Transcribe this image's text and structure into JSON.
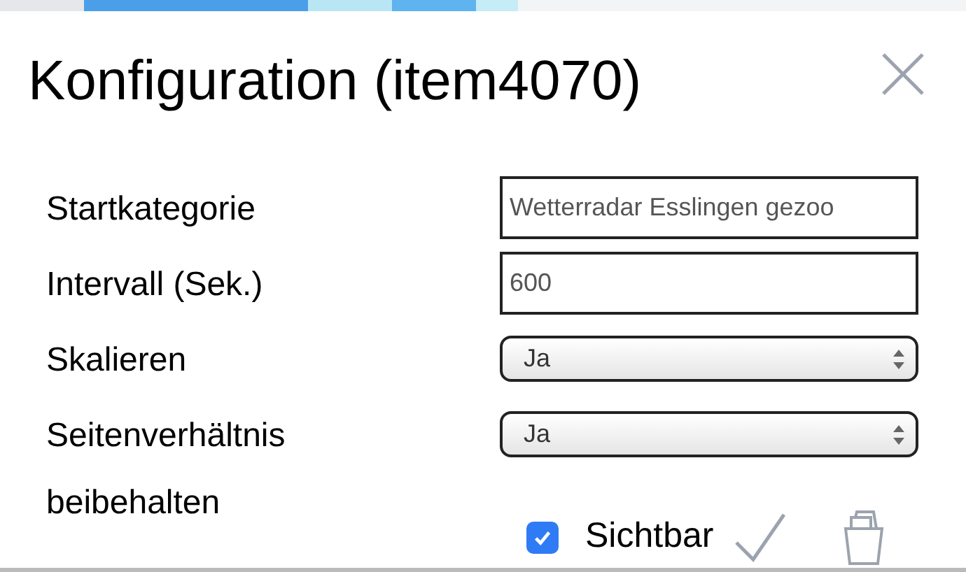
{
  "dialog": {
    "title": "Konfiguration (item4070)",
    "fields": [
      {
        "label": "Startkategorie",
        "kind": "input",
        "value": "Wetterradar Esslingen gezoo"
      },
      {
        "label": "Intervall (Sek.)",
        "kind": "input",
        "value": "600"
      },
      {
        "label": "Skalieren",
        "kind": "select",
        "value": "Ja"
      },
      {
        "label": "Seitenverhältnis beibehalten",
        "kind": "select",
        "value": "Ja"
      }
    ],
    "visible": {
      "label": "Sichtbar",
      "checked": true
    }
  }
}
